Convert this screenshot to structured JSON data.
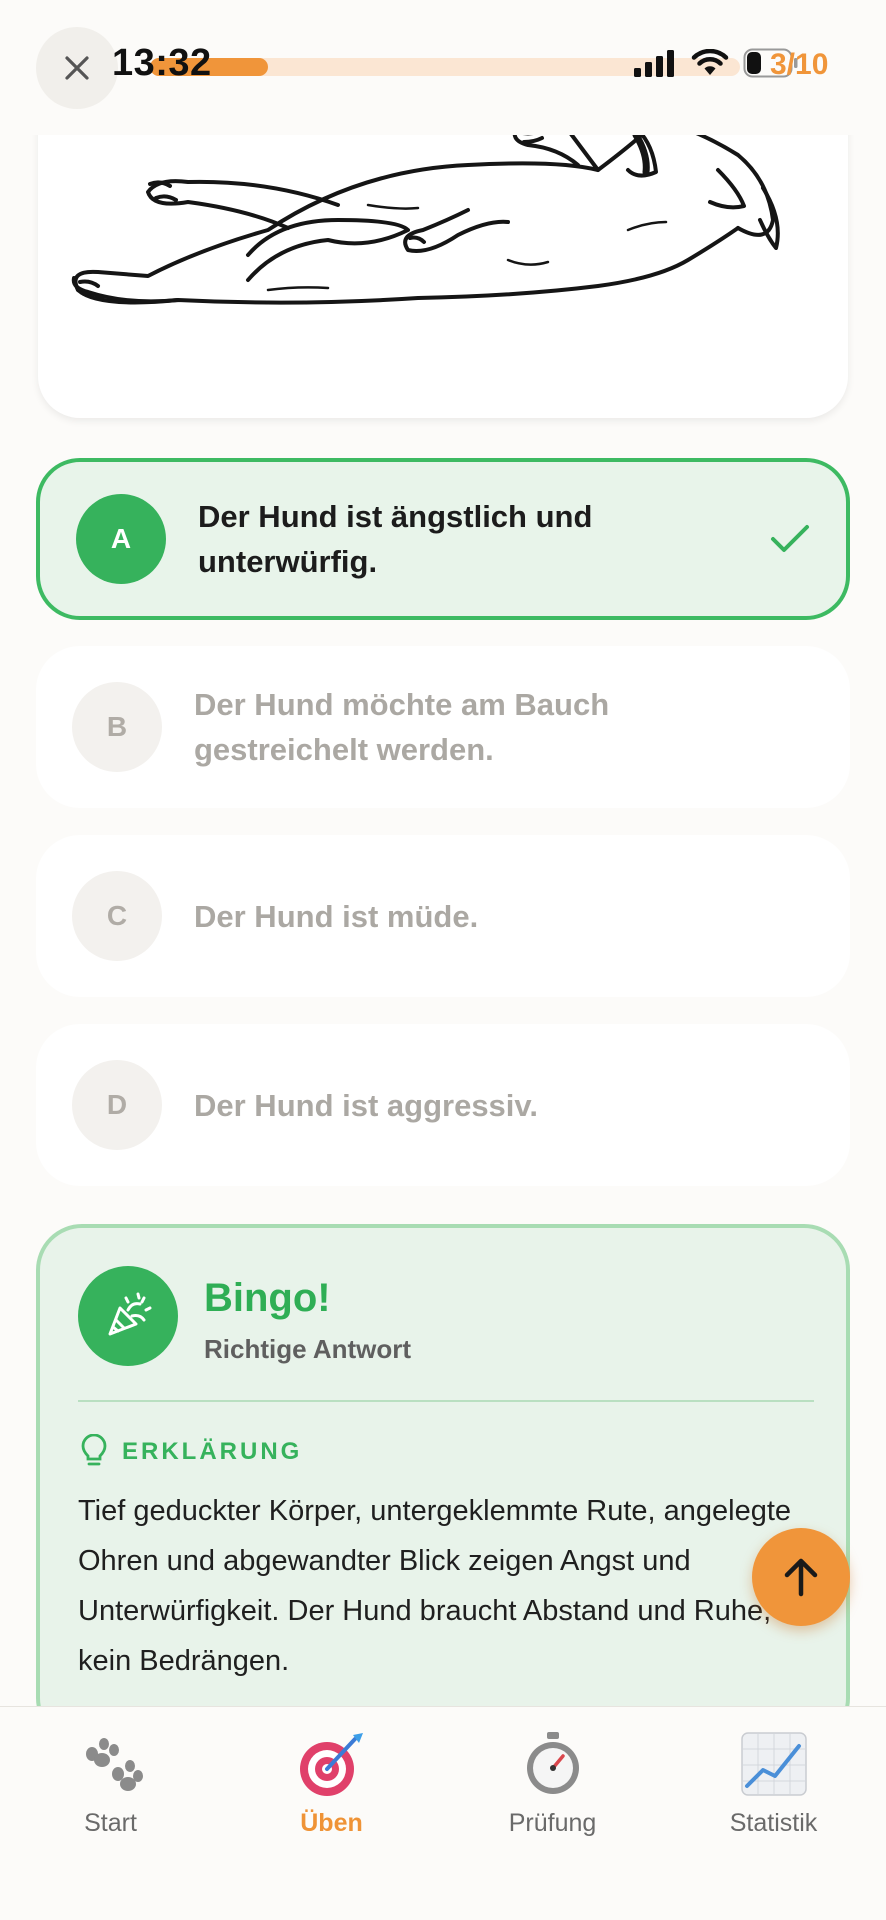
{
  "status_bar": {
    "time": "13:32"
  },
  "header": {
    "close_icon": "close-icon",
    "progress": 0.2,
    "counter": "3/10"
  },
  "question": {
    "image": "dog-lying-on-back-illustration"
  },
  "options": [
    {
      "letter": "A",
      "text": "Der Hund ist ängstlich und unterwürfig.",
      "state": "correct"
    },
    {
      "letter": "B",
      "text": "Der Hund möchte am Bauch gestreichelt werden.",
      "state": "muted"
    },
    {
      "letter": "C",
      "text": "Der Hund ist müde.",
      "state": "muted"
    },
    {
      "letter": "D",
      "text": "Der Hund ist aggressiv.",
      "state": "muted"
    }
  ],
  "result": {
    "icon": "party-popper-icon",
    "title": "Bingo!",
    "subtitle": "Richtige Antwort",
    "explanation_label": "ERKLÄRUNG",
    "explanation": "Tief geduckter Körper, untergeklemmte Rute, angelegte Ohren und abgewandter Blick zeigen Angst und Unterwürfigkeit. Der Hund braucht Abstand und Ruhe, kein Bedrängen."
  },
  "nav": {
    "items": [
      {
        "label": "Start",
        "icon": "paw-prints-icon"
      },
      {
        "label": "Üben",
        "icon": "target-dart-icon",
        "active": true
      },
      {
        "label": "Prüfung",
        "icon": "stopwatch-icon"
      },
      {
        "label": "Statistik",
        "icon": "chart-increasing-icon"
      }
    ]
  },
  "colors": {
    "accent": "#f0953a",
    "correct": "#36b25c",
    "correct_bg": "#e8f4ea",
    "muted_text": "#aba8a3"
  }
}
